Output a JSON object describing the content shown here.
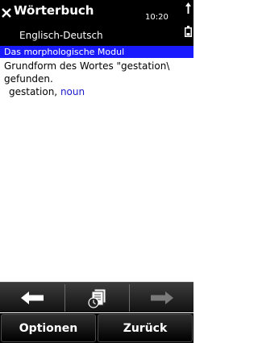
{
  "header": {
    "title": "Wörterbuch",
    "subtitle": "Englisch-Deutsch",
    "time": "10:20"
  },
  "content": {
    "module_label": "Das morphologische Modul",
    "result_line1": "Grundform des Wortes \"gestation\\",
    "result_line2": "gefunden.",
    "entry_word": "gestation",
    "entry_separator": ",",
    "entry_pos": "noun"
  },
  "toolbar": {
    "items": [
      {
        "icon": "arrow-left-icon",
        "enabled": true
      },
      {
        "icon": "history-icon",
        "enabled": true
      },
      {
        "icon": "arrow-right-icon",
        "enabled": false
      }
    ]
  },
  "softkeys": {
    "left": "Optionen",
    "right": "Zurück"
  },
  "colors": {
    "highlight_bar": "#1a1aff",
    "pos_text": "#1a1ad0"
  }
}
